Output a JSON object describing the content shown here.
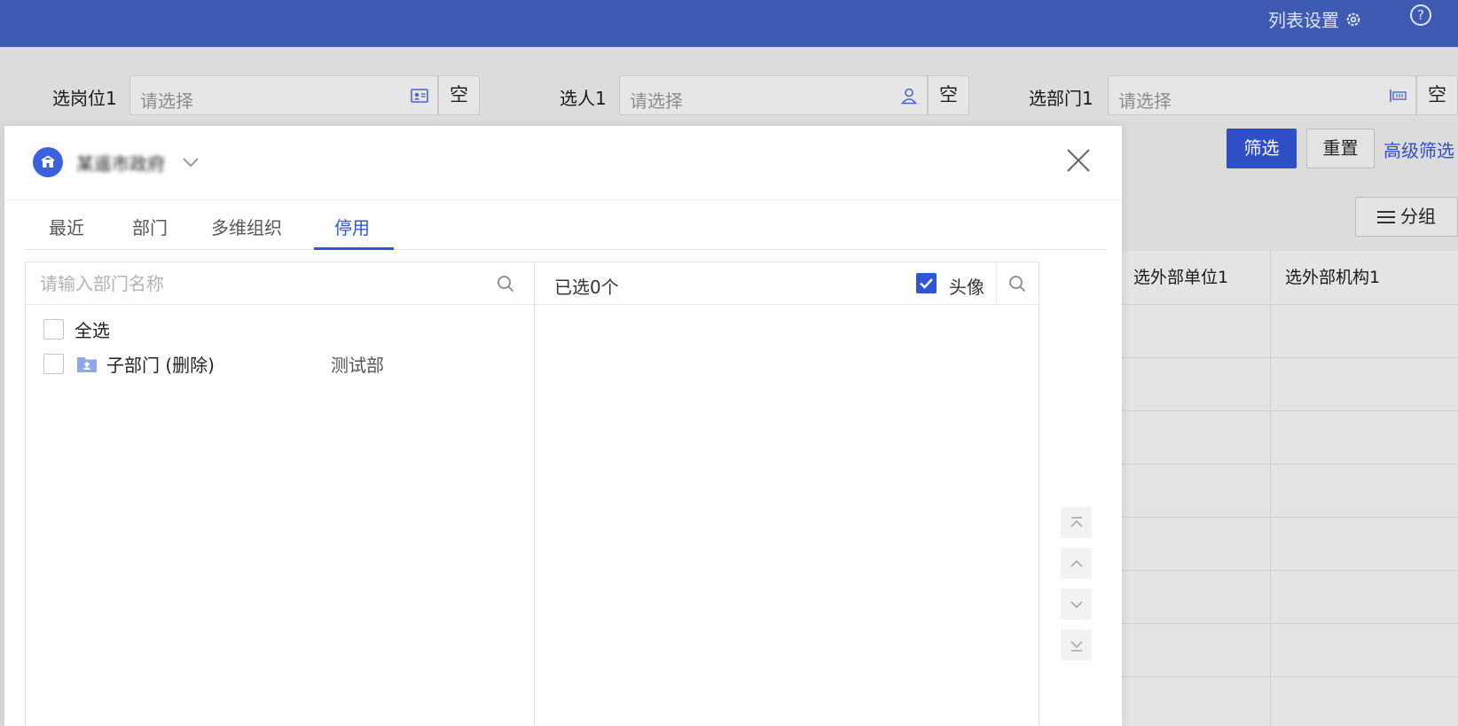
{
  "topbar": {
    "list_settings_label": "列表设置",
    "help_label": "?"
  },
  "filters": [
    {
      "label": "选岗位1",
      "placeholder": "请选择",
      "empty_label": "空",
      "icon": "id-card-icon"
    },
    {
      "label": "选人1",
      "placeholder": "请选择",
      "empty_label": "空",
      "icon": "person-icon"
    },
    {
      "label": "选部门1",
      "placeholder": "请选择",
      "empty_label": "空",
      "icon": "org-chart-icon"
    }
  ],
  "actions": {
    "filter_label": "筛选",
    "reset_label": "重置",
    "advanced_label": "高级筛选",
    "group_label": "分组"
  },
  "table": {
    "headers": [
      "选外部单位1",
      "选外部机构1"
    ]
  },
  "modal": {
    "org_name": "某遥市政府",
    "tabs": [
      {
        "label": "最近",
        "active": false
      },
      {
        "label": "部门",
        "active": false
      },
      {
        "label": "多维组织",
        "active": false
      },
      {
        "label": "停用",
        "active": true
      }
    ],
    "left": {
      "search_placeholder": "请输入部门名称",
      "select_all_label": "全选",
      "items": [
        {
          "name": "子部门 (删除)",
          "path": "测试部"
        }
      ]
    },
    "right": {
      "selected_count_label": "已选0个",
      "avatar_label": "头像",
      "avatar_checked": true
    },
    "move_buttons": [
      "move-top-icon",
      "move-up-icon",
      "move-down-icon",
      "move-bottom-icon"
    ]
  },
  "colors": {
    "topbar": "#3f5ab3",
    "accent": "#2f56d6",
    "primary_button": "#2f4fc7"
  }
}
